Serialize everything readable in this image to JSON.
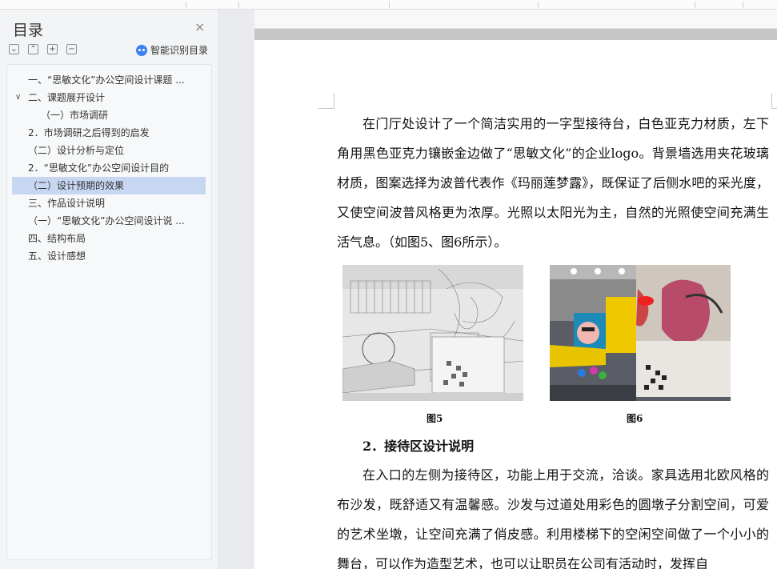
{
  "nav": {
    "title": "目录",
    "close_glyph": "×",
    "tools": [
      "⌄",
      "⌃",
      "+",
      "−"
    ],
    "smart_label": "智能识别目录",
    "items": [
      {
        "label": "一、“思敏文化”办公空间设计课题 ...",
        "level": 1,
        "active": false,
        "expanded": false
      },
      {
        "label": "二、课题展开设计",
        "level": 1,
        "active": false,
        "expanded": true
      },
      {
        "label": "（一）市场调研",
        "level": 2,
        "active": false,
        "expanded": false
      },
      {
        "label": "2．市场调研之后得到的启发",
        "level": 1,
        "active": false,
        "expanded": false
      },
      {
        "label": "（二）设计分析与定位",
        "level": 1,
        "active": false,
        "expanded": false
      },
      {
        "label": "2．“思敏文化”办公空间设计目的",
        "level": 1,
        "active": false,
        "expanded": false
      },
      {
        "label": "（二）设计预期的效果",
        "level": 1,
        "active": true,
        "expanded": false
      },
      {
        "label": "三、作品设计说明",
        "level": 1,
        "active": false,
        "expanded": false
      },
      {
        "label": "（一）“思敏文化”办公空间设计说 ...",
        "level": 1,
        "active": false,
        "expanded": false
      },
      {
        "label": "四、结构布局",
        "level": 1,
        "active": false,
        "expanded": false
      },
      {
        "label": "五、设计感想",
        "level": 1,
        "active": false,
        "expanded": false
      }
    ]
  },
  "doc": {
    "para1": "在门厅处设计了一个简洁实用的一字型接待台，白色亚克力材质，左下角用黑色亚克力镶嵌金边做了“思敏文化”的企业logo。背景墙选用夹花玻璃材质，图案选择为波普代表作《玛丽莲梦露》，既保证了后侧水吧的采光度，又使空间波普风格更为浓厚。光照以太阳光为主，自然的光照使空间充满生活气息。（如图5、图6所示）。",
    "fig5_caption": "图5",
    "fig6_caption": "图6",
    "heading2": "2．接待区设计说明",
    "para2": "在入口的左侧为接待区，功能上用于交流，洽谈。家具选用北欧风格的布沙发，既舒适又有温馨感。沙发与过道处用彩色的圆墩子分割空间，可爱的艺术坐墩，让空间充满了俏皮感。利用楼梯下的空闲空间做了一个小小的舞台，可以作为造型艺术，也可以让职员在公司有活动时，发挥自"
  },
  "colors": {
    "active_bg": "#c7d7f2",
    "accent": "#3b82f6"
  }
}
